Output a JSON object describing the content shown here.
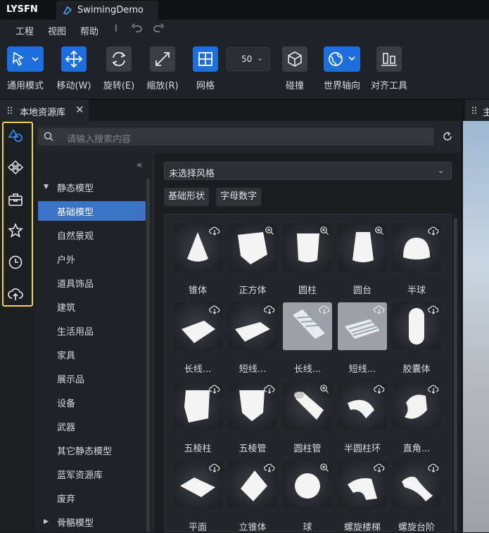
{
  "titlebar": {
    "logo": "LYSFN",
    "doc_tab": "SwimingDemo"
  },
  "menu": {
    "items": [
      "工程",
      "视图",
      "帮助"
    ],
    "separator": "I"
  },
  "toolbar": {
    "buttons": [
      {
        "label": "通用模式",
        "icon": "pointer-icon"
      },
      {
        "label": "移动(W)",
        "icon": "move-icon"
      },
      {
        "label": "旋转(E)",
        "icon": "rotate-icon"
      },
      {
        "label": "缩放(R)",
        "icon": "scale-icon"
      },
      {
        "label": "网格",
        "icon": "grid-icon"
      },
      {
        "label": "碰撞",
        "icon": "collision-icon"
      },
      {
        "label": "世界轴向",
        "icon": "world-axis-icon"
      },
      {
        "label": "对齐工具",
        "icon": "align-icon"
      }
    ],
    "grid_size": "50"
  },
  "panel": {
    "title": "本地资源库",
    "right_tab": "主"
  },
  "search": {
    "placeholder": "请输入搜索内容"
  },
  "tree": {
    "items": [
      {
        "label": "静态模型",
        "type": "parent"
      },
      {
        "label": "基础模型",
        "type": "child",
        "selected": true
      },
      {
        "label": "自然景观",
        "type": "child"
      },
      {
        "label": "户外",
        "type": "child"
      },
      {
        "label": "道具饰品",
        "type": "child"
      },
      {
        "label": "建筑",
        "type": "child"
      },
      {
        "label": "生活用品",
        "type": "child"
      },
      {
        "label": "家具",
        "type": "child"
      },
      {
        "label": "展示品",
        "type": "child"
      },
      {
        "label": "设备",
        "type": "child"
      },
      {
        "label": "武器",
        "type": "child"
      },
      {
        "label": "其它静态模型",
        "type": "child"
      },
      {
        "label": "蓝军资源库",
        "type": "child"
      },
      {
        "label": "废弃",
        "type": "child"
      },
      {
        "label": "骨骼模型",
        "type": "parent-collapsed"
      }
    ]
  },
  "style_filter": "未选择风格",
  "chips": [
    "基础形状",
    "字母数字"
  ],
  "assets": [
    {
      "name": "锥体",
      "badge": "download"
    },
    {
      "name": "正方体",
      "badge": "zoom"
    },
    {
      "name": "圆柱",
      "badge": "zoom"
    },
    {
      "name": "圆台",
      "badge": "zoom"
    },
    {
      "name": "半球",
      "badge": "download"
    },
    {
      "name": "长线...",
      "badge": "download"
    },
    {
      "name": "短线...",
      "badge": "download"
    },
    {
      "name": "长线...",
      "badge": "download"
    },
    {
      "name": "短线...",
      "badge": "download"
    },
    {
      "name": "胶囊体",
      "badge": "download"
    },
    {
      "name": "五棱柱",
      "badge": "download"
    },
    {
      "name": "五棱管",
      "badge": "download"
    },
    {
      "name": "圆柱管",
      "badge": "zoom"
    },
    {
      "name": "半圆柱环",
      "badge": "download"
    },
    {
      "name": "直角...",
      "badge": "download"
    },
    {
      "name": "平面",
      "badge": "download"
    },
    {
      "name": "立锥体",
      "badge": "download"
    },
    {
      "name": "球",
      "badge": "zoom"
    },
    {
      "name": "螺旋楼梯",
      "badge": "download"
    },
    {
      "name": "螺旋台阶",
      "badge": "download"
    }
  ],
  "colors": {
    "accent": "#1d6fe0",
    "selection": "#3b73c7",
    "highlight_frame": "#f1d54a"
  }
}
